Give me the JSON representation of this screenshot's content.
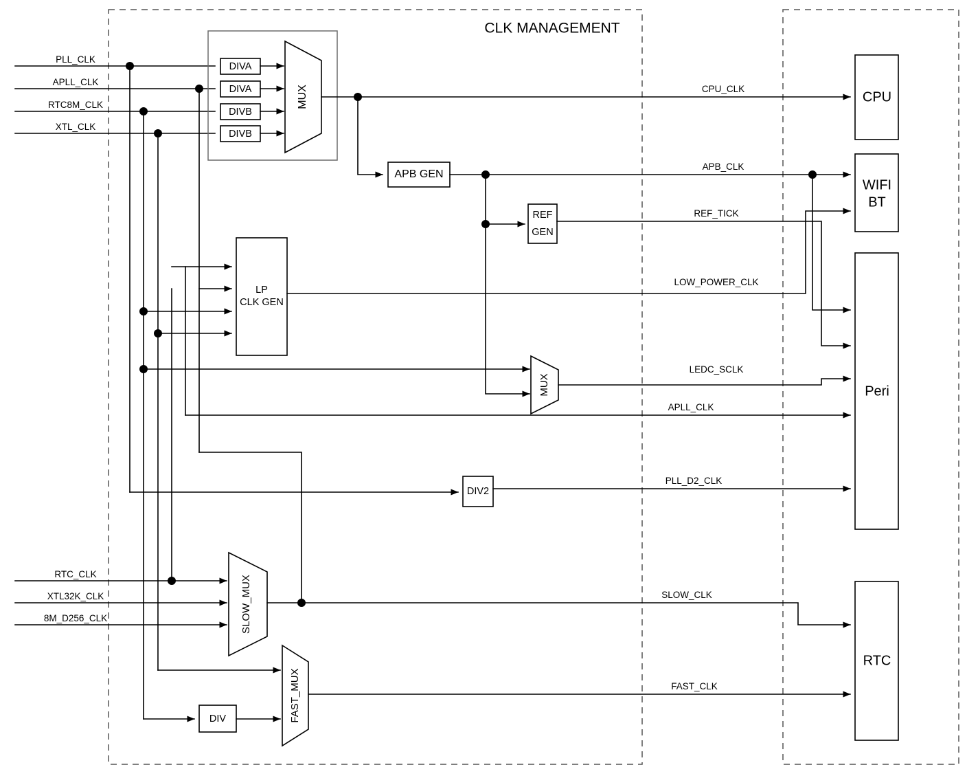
{
  "title": "CLK MANAGEMENT",
  "regions": [
    {
      "name": "clk-management-region",
      "label": "CLK MANAGEMENT"
    },
    {
      "name": "destination-region",
      "label": ""
    }
  ],
  "inputs_top": [
    {
      "label": "PLL_CLK"
    },
    {
      "label": "APLL_CLK"
    },
    {
      "label": "RTC8M_CLK"
    },
    {
      "label": "XTL_CLK"
    }
  ],
  "inputs_bottom": [
    {
      "label": "RTC_CLK"
    },
    {
      "label": "XTL32K_CLK"
    },
    {
      "label": "8M_D256_CLK"
    }
  ],
  "dividers": [
    {
      "label": "DIVA"
    },
    {
      "label": "DIVA"
    },
    {
      "label": "DIVB"
    },
    {
      "label": "DIVB"
    }
  ],
  "blocks": {
    "main_mux": "MUX",
    "apb_gen": "APB GEN",
    "ref_gen_line1": "REF",
    "ref_gen_line2": "GEN",
    "lp_clk_gen_line1": "LP",
    "lp_clk_gen_line2": "CLK GEN",
    "ledc_mux": "MUX",
    "div2": "DIV2",
    "slow_mux": "SLOW_MUX",
    "fast_mux": "FAST_MUX",
    "div": "DIV"
  },
  "signals": [
    {
      "label": "CPU_CLK"
    },
    {
      "label": "APB_CLK"
    },
    {
      "label": "REF_TICK"
    },
    {
      "label": "LOW_POWER_CLK"
    },
    {
      "label": "LEDC_SCLK"
    },
    {
      "label": "APLL_CLK"
    },
    {
      "label": "PLL_D2_CLK"
    },
    {
      "label": "SLOW_CLK"
    },
    {
      "label": "FAST_CLK"
    }
  ],
  "destinations": [
    {
      "label": "CPU"
    },
    {
      "label_line1": "WIFI",
      "label_line2": "BT"
    },
    {
      "label": "Peri"
    },
    {
      "label": "RTC"
    }
  ],
  "colors": {
    "line": "#000000",
    "region_border": "#555555",
    "group_border": "#6b6b6b",
    "background": "#ffffff"
  }
}
